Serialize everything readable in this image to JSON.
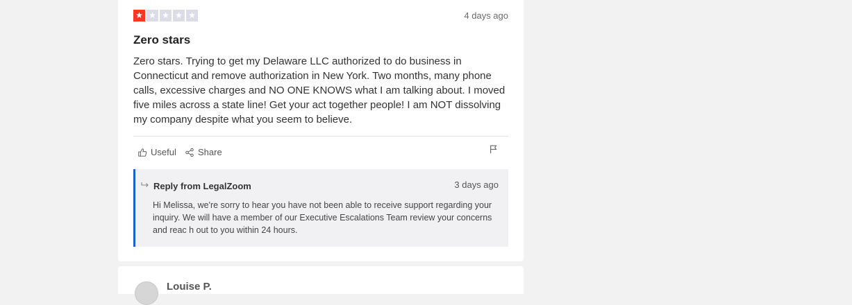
{
  "review": {
    "rating": 1,
    "max_rating": 5,
    "star_glyph": "★",
    "date": "4 days ago",
    "title": "Zero stars",
    "body": "Zero stars. Trying to get my Delaware LLC authorized to do business in Connecticut and remove authorization in New York. Two months, many phone calls, excessive charges and NO ONE KNOWS what I am talking about. I moved five miles across a state line! Get your act together people! I am NOT dissolving my company despite what you seem to believe.",
    "actions": {
      "useful_label": "Useful",
      "share_label": "Share"
    },
    "colors": {
      "star_on": "#ff3722",
      "star_off": "#dcdce6",
      "reply_accent": "#1c5fd2"
    }
  },
  "reply": {
    "from": "Reply from LegalZoom",
    "date": "3 days ago",
    "body": "Hi Melissa, we're sorry to hear you have not been able to receive support regarding your inquiry. We will have a member of our Executive Escalations Team review your concerns and reac h out to you within 24 hours."
  },
  "next_review": {
    "name": "Louise P."
  }
}
